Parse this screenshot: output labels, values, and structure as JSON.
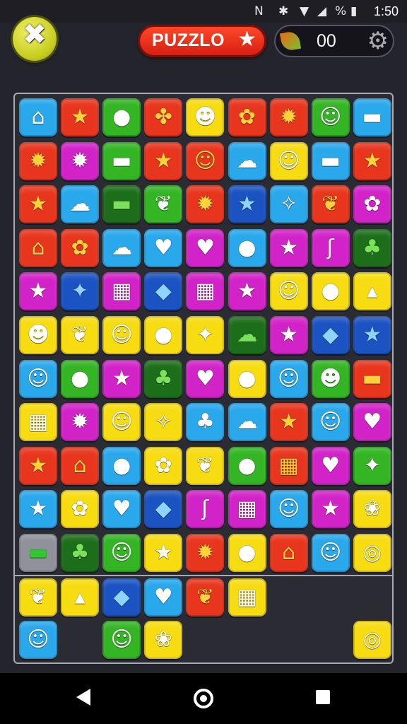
{
  "status_bar": {
    "time": "1:50",
    "icons": [
      {
        "name": "nfc-icon",
        "glyph": "N"
      },
      {
        "name": "bluetooth-icon",
        "glyph": "✱"
      },
      {
        "name": "wifi-icon",
        "glyph": "▼"
      },
      {
        "name": "signal-icon",
        "glyph": "◢"
      },
      {
        "name": "data-saver-icon",
        "glyph": "%"
      },
      {
        "name": "battery-icon",
        "glyph": "▮"
      }
    ]
  },
  "header": {
    "quit_glyph": "✖",
    "title": "PUZZLO",
    "title_star": "★",
    "score": "00",
    "gear_glyph": "⚙"
  },
  "colors": {
    "blue": "#29a8ec",
    "red": "#e8361e",
    "green": "#33b524",
    "yellow": "#f7dc12",
    "magenta": "#d223c8",
    "dkgreen": "#1d6e1a",
    "dkblue": "#1c53c2",
    "gray": "#8f9299"
  },
  "icon_glyphs": {
    "house": "⌂",
    "star": "★",
    "fruit": "●",
    "fleur": "✤",
    "cat-face": "☻",
    "flower": "✿",
    "bug": "✹",
    "face": "☺",
    "block": "▬",
    "ghost": "☁",
    "leaf": "❦",
    "palm": "♣",
    "heart": "♥",
    "drop": "◆",
    "tower": "▦",
    "grain": "✧",
    "splash": "✦",
    "bunny": "☺",
    "wheat": "♠",
    "target": "◎",
    "bars": "▦",
    "hook": "ʃ",
    "seal": "▴",
    "shell": "❀",
    "note": "♬"
  },
  "board": {
    "rows": [
      [
        {
          "c": "blue",
          "i": "house",
          "name": "house-icon"
        },
        {
          "c": "red",
          "i": "star",
          "name": "starfruit-icon"
        },
        {
          "c": "green",
          "i": "fruit",
          "name": "orange-icon"
        },
        {
          "c": "red",
          "i": "fleur",
          "name": "fleur-icon"
        },
        {
          "c": "yellow",
          "i": "cat-face",
          "name": "cat-face-icon"
        },
        {
          "c": "red",
          "i": "flower",
          "name": "flower-icon"
        },
        {
          "c": "red",
          "i": "bug",
          "name": "bug-icon"
        },
        {
          "c": "green",
          "i": "face",
          "name": "face-icon"
        },
        {
          "c": "blue",
          "i": "block",
          "name": "block-icon"
        }
      ],
      [
        {
          "c": "red",
          "i": "bug",
          "name": "bug-icon"
        },
        {
          "c": "magenta",
          "i": "bug",
          "name": "bug-icon"
        },
        {
          "c": "green",
          "i": "block",
          "name": "block-icon"
        },
        {
          "c": "red",
          "i": "star",
          "name": "star-icon"
        },
        {
          "c": "red",
          "i": "face",
          "name": "face-icon"
        },
        {
          "c": "blue",
          "i": "ghost",
          "name": "ghost-icon"
        },
        {
          "c": "yellow",
          "i": "face",
          "name": "face-icon"
        },
        {
          "c": "blue",
          "i": "block",
          "name": "block-icon"
        },
        {
          "c": "red",
          "i": "star",
          "name": "star-icon"
        }
      ],
      [
        {
          "c": "red",
          "i": "star",
          "name": "star-icon"
        },
        {
          "c": "blue",
          "i": "ghost",
          "name": "ghost-icon"
        },
        {
          "c": "dkgreen",
          "i": "block",
          "name": "block-icon"
        },
        {
          "c": "green",
          "i": "leaf",
          "name": "leaf-icon"
        },
        {
          "c": "red",
          "i": "bug",
          "name": "bug-icon"
        },
        {
          "c": "dkblue",
          "i": "star",
          "name": "star-icon"
        },
        {
          "c": "blue",
          "i": "grain",
          "name": "tree-icon"
        },
        {
          "c": "red",
          "i": "leaf",
          "name": "leaf-icon"
        },
        {
          "c": "magenta",
          "i": "flower",
          "name": "flower-icon"
        }
      ],
      [
        {
          "c": "red",
          "i": "house",
          "name": "tower-icon"
        },
        {
          "c": "red",
          "i": "flower",
          "name": "flower-icon"
        },
        {
          "c": "blue",
          "i": "ghost",
          "name": "ghost-icon"
        },
        {
          "c": "blue",
          "i": "heart",
          "name": "heart-icon"
        },
        {
          "c": "magenta",
          "i": "heart",
          "name": "heart-icon"
        },
        {
          "c": "blue",
          "i": "fruit",
          "name": "orange-icon"
        },
        {
          "c": "magenta",
          "i": "star",
          "name": "star-icon"
        },
        {
          "c": "magenta",
          "i": "hook",
          "name": "hook-icon"
        },
        {
          "c": "dkgreen",
          "i": "palm",
          "name": "palm-icon"
        }
      ],
      [
        {
          "c": "magenta",
          "i": "star",
          "name": "star-icon"
        },
        {
          "c": "dkblue",
          "i": "splash",
          "name": "splash-icon"
        },
        {
          "c": "magenta",
          "i": "tower",
          "name": "tower-icon"
        },
        {
          "c": "dkblue",
          "i": "drop",
          "name": "drop-icon"
        },
        {
          "c": "magenta",
          "i": "tower",
          "name": "tower-icon"
        },
        {
          "c": "magenta",
          "i": "star",
          "name": "star-icon"
        },
        {
          "c": "yellow",
          "i": "face",
          "name": "face-icon"
        },
        {
          "c": "yellow",
          "i": "fruit",
          "name": "pepper-icon"
        },
        {
          "c": "yellow",
          "i": "seal",
          "name": "seal-icon"
        }
      ],
      [
        {
          "c": "yellow",
          "i": "cat-face",
          "name": "cat-face-icon"
        },
        {
          "c": "yellow",
          "i": "leaf",
          "name": "leaf-icon"
        },
        {
          "c": "yellow",
          "i": "face",
          "name": "face-icon"
        },
        {
          "c": "yellow",
          "i": "fruit",
          "name": "apple-icon"
        },
        {
          "c": "yellow",
          "i": "splash",
          "name": "splash-icon"
        },
        {
          "c": "dkgreen",
          "i": "ghost",
          "name": "ghost-icon"
        },
        {
          "c": "magenta",
          "i": "star",
          "name": "star-icon"
        },
        {
          "c": "dkblue",
          "i": "drop",
          "name": "drop-icon"
        },
        {
          "c": "dkblue",
          "i": "star",
          "name": "star-icon"
        }
      ],
      [
        {
          "c": "blue",
          "i": "bunny",
          "name": "bunny-icon"
        },
        {
          "c": "green",
          "i": "fruit",
          "name": "orange-icon"
        },
        {
          "c": "magenta",
          "i": "star",
          "name": "star-icon"
        },
        {
          "c": "dkgreen",
          "i": "palm",
          "name": "palm-icon"
        },
        {
          "c": "magenta",
          "i": "heart",
          "name": "heart-icon"
        },
        {
          "c": "yellow",
          "i": "fruit",
          "name": "apple-icon"
        },
        {
          "c": "blue",
          "i": "face",
          "name": "face-icon"
        },
        {
          "c": "green",
          "i": "cat-face",
          "name": "cat-face-icon"
        },
        {
          "c": "red",
          "i": "block",
          "name": "block-icon"
        }
      ],
      [
        {
          "c": "yellow",
          "i": "bars",
          "name": "bars-icon"
        },
        {
          "c": "magenta",
          "i": "bug",
          "name": "bug-icon"
        },
        {
          "c": "yellow",
          "i": "face",
          "name": "face-icon"
        },
        {
          "c": "yellow",
          "i": "grain",
          "name": "tree-icon"
        },
        {
          "c": "blue",
          "i": "palm",
          "name": "palm-icon"
        },
        {
          "c": "blue",
          "i": "ghost",
          "name": "ghost-icon"
        },
        {
          "c": "red",
          "i": "star",
          "name": "star-icon"
        },
        {
          "c": "blue",
          "i": "bunny",
          "name": "bunny-icon"
        },
        {
          "c": "magenta",
          "i": "heart",
          "name": "heart-icon"
        }
      ],
      [
        {
          "c": "red",
          "i": "star",
          "name": "starfruit-icon"
        },
        {
          "c": "red",
          "i": "house",
          "name": "house-icon"
        },
        {
          "c": "blue",
          "i": "fruit",
          "name": "orange-icon"
        },
        {
          "c": "yellow",
          "i": "flower",
          "name": "flower-icon"
        },
        {
          "c": "yellow",
          "i": "leaf",
          "name": "leaf-icon"
        },
        {
          "c": "green",
          "i": "fruit",
          "name": "orange-icon"
        },
        {
          "c": "red",
          "i": "bars",
          "name": "bars-icon"
        },
        {
          "c": "magenta",
          "i": "heart",
          "name": "heart-icon"
        },
        {
          "c": "green",
          "i": "splash",
          "name": "splash-icon"
        }
      ],
      [
        {
          "c": "blue",
          "i": "star",
          "name": "star-icon"
        },
        {
          "c": "yellow",
          "i": "flower",
          "name": "flower-icon"
        },
        {
          "c": "blue",
          "i": "heart",
          "name": "petal-icon"
        },
        {
          "c": "dkblue",
          "i": "drop",
          "name": "drop-icon"
        },
        {
          "c": "magenta",
          "i": "hook",
          "name": "hook-icon"
        },
        {
          "c": "magenta",
          "i": "tower",
          "name": "tower-icon"
        },
        {
          "c": "blue",
          "i": "bunny",
          "name": "bunny-icon"
        },
        {
          "c": "magenta",
          "i": "star",
          "name": "star-icon"
        },
        {
          "c": "yellow",
          "i": "shell",
          "name": "shell-flower-icon"
        }
      ],
      [
        {
          "c": "gray",
          "i": "block",
          "name": "block-icon"
        },
        {
          "c": "dkgreen",
          "i": "palm",
          "name": "palm-icon"
        },
        {
          "c": "green",
          "i": "face",
          "name": "face-icon"
        },
        {
          "c": "yellow",
          "i": "star",
          "name": "star-icon"
        },
        {
          "c": "red",
          "i": "bug",
          "name": "bug-icon"
        },
        {
          "c": "yellow",
          "i": "fruit",
          "name": "apple-icon"
        },
        {
          "c": "red",
          "i": "house",
          "name": "house-icon"
        },
        {
          "c": "blue",
          "i": "bunny",
          "name": "bunny-icon"
        },
        {
          "c": "yellow",
          "i": "target",
          "name": "target-icon"
        }
      ]
    ]
  },
  "tray": [
    {
      "row": 0,
      "col": 0,
      "c": "yellow",
      "i": "leaf",
      "name": "leaf-icon"
    },
    {
      "row": 0,
      "col": 1,
      "c": "yellow",
      "i": "seal",
      "name": "seal-icon"
    },
    {
      "row": 0,
      "col": 2,
      "c": "dkblue",
      "i": "drop",
      "name": "drop-icon"
    },
    {
      "row": 0,
      "col": 3,
      "c": "blue",
      "i": "heart",
      "name": "heart-icon"
    },
    {
      "row": 0,
      "col": 4,
      "c": "red",
      "i": "leaf",
      "name": "leaf-icon"
    },
    {
      "row": 0,
      "col": 5,
      "c": "yellow",
      "i": "bars",
      "name": "bars-icon"
    },
    {
      "row": 1,
      "col": 0,
      "c": "blue",
      "i": "bunny",
      "name": "bunny-icon"
    },
    {
      "row": 1,
      "col": 2,
      "c": "green",
      "i": "bunny",
      "name": "bunny-icon"
    },
    {
      "row": 1,
      "col": 3,
      "c": "yellow",
      "i": "shell",
      "name": "shell-flower-icon"
    },
    {
      "row": 1,
      "col": 8,
      "c": "yellow",
      "i": "target",
      "name": "target-icon"
    }
  ]
}
